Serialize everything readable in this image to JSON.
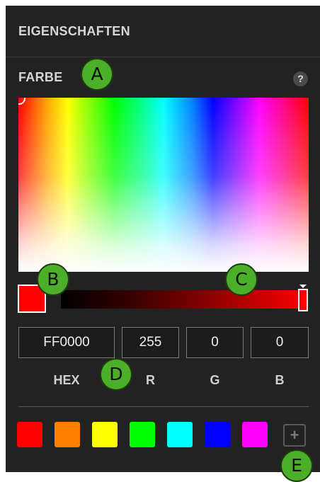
{
  "header": {
    "title": "EIGENSCHAFTEN"
  },
  "color_section": {
    "title": "FARBE",
    "help_icon_glyph": "?",
    "current_color": "#ff0000"
  },
  "fields": {
    "hex": {
      "value": "FF0000",
      "label": "HEX"
    },
    "r": {
      "value": "255",
      "label": "R"
    },
    "g": {
      "value": "0",
      "label": "G"
    },
    "b": {
      "value": "0",
      "label": "B"
    }
  },
  "presets": [
    {
      "name": "red",
      "color": "#ff0000"
    },
    {
      "name": "orange",
      "color": "#ff8000"
    },
    {
      "name": "yellow",
      "color": "#ffff00"
    },
    {
      "name": "green",
      "color": "#00ff00"
    },
    {
      "name": "cyan",
      "color": "#00ffff"
    },
    {
      "name": "blue",
      "color": "#0000ff"
    },
    {
      "name": "magenta",
      "color": "#ff00ff"
    }
  ],
  "add_preset_glyph": "+",
  "callouts": {
    "a": "A",
    "b": "B",
    "c": "C",
    "d": "D",
    "e": "E"
  }
}
